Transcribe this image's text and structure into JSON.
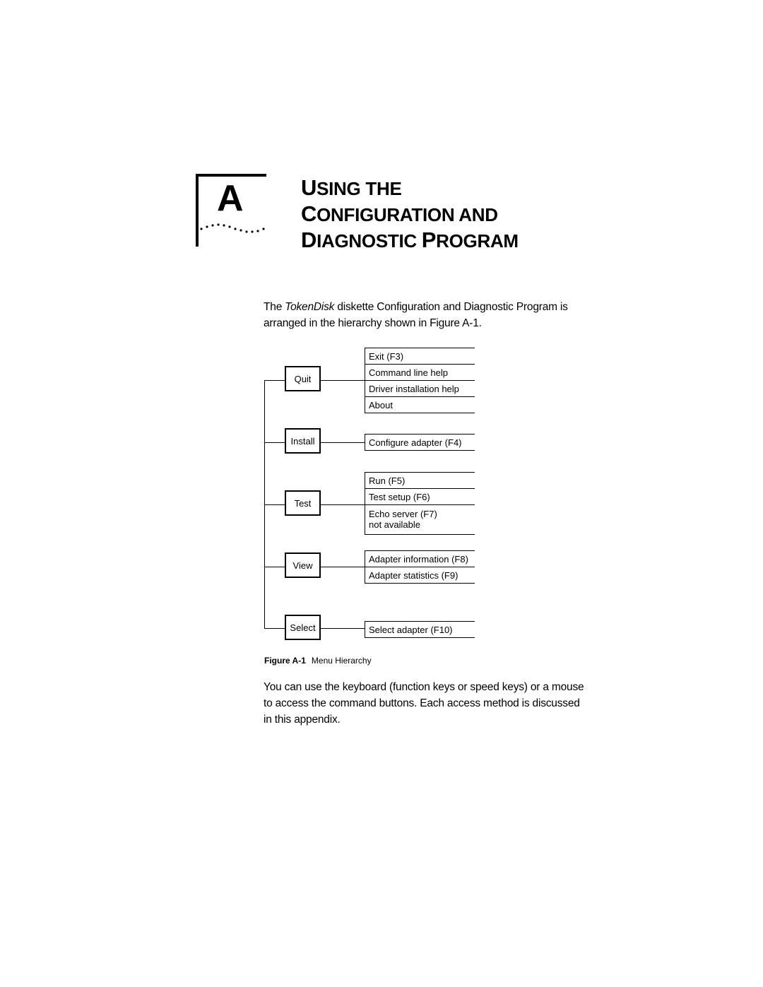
{
  "chapter": {
    "letter": "A",
    "title_lines": [
      [
        {
          "cap": "U",
          "rest": "SING THE"
        }
      ],
      [
        {
          "cap": "C",
          "rest": "ONFIGURATION AND"
        }
      ],
      [
        {
          "cap": "D",
          "rest": "IAGNOSTIC "
        },
        {
          "cap": "P",
          "rest": "ROGRAM"
        }
      ]
    ]
  },
  "intro": {
    "prefix": "The ",
    "product": "TokenDisk",
    "suffix": " diskette Configuration and Diagnostic Program is arranged in the hierarchy shown in Figure A-1."
  },
  "figure": {
    "menus": [
      {
        "label": "Quit",
        "items": [
          "Exit (F3)",
          "Command line help",
          "Driver installation help",
          "About"
        ]
      },
      {
        "label": "Install",
        "items": [
          "Configure adapter (F4)"
        ]
      },
      {
        "label": "Test",
        "items": [
          "Run (F5)",
          "Test setup (F6)",
          "Echo server (F7)\nnot available"
        ]
      },
      {
        "label": "View",
        "items": [
          "Adapter information (F8)",
          "Adapter statistics (F9)"
        ]
      },
      {
        "label": "Select",
        "items": [
          "Select adapter (F10)"
        ]
      }
    ],
    "caption_label": "Figure A-1",
    "caption_text": "Menu Hierarchy"
  },
  "outro": {
    "text": "You can use the keyboard (function keys or speed keys) or a mouse to access the command buttons. Each access method is discussed in this appendix."
  }
}
